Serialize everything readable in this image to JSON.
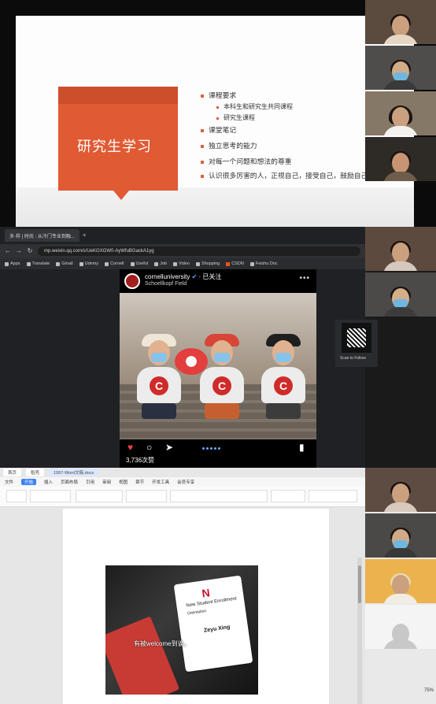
{
  "slide": {
    "title": "研究生学习",
    "bullets": [
      "课程要求",
      "本科生和研究生共同课程",
      "研究生课程",
      "课堂笔记",
      "独立思考的能力",
      "对每一个问题和想法的尊重",
      "认识很多厉害的人，正视自己，接受自己，鼓励自己"
    ]
  },
  "browser": {
    "tab_title": "多·样 | 时尚 : 从冷门专业到融...",
    "new_tab_symbol": "+",
    "url": "mp.weixin.qq.com/s/UeKGXGW0-AyWfuBGackA1yg",
    "bookmarks": [
      "Apps",
      "Translate",
      "Gmail",
      "Udemy",
      "Cornell",
      "Useful",
      "Job",
      "Video",
      "Shopping",
      "CSDN",
      "Feishu Doc"
    ],
    "post": {
      "user": "cornelluniversity",
      "follow_text": "· 已关注",
      "location": "Schoellkopf Field",
      "likes": "3,736次赞"
    },
    "qr_label": "Scan to Follow"
  },
  "wps": {
    "tabs": [
      "首页",
      "稻壳",
      "1997-Word文稿.docx"
    ],
    "menu": [
      "文件",
      "开始",
      "插入",
      "页面布局",
      "引用",
      "审阅",
      "视图",
      "章节",
      "开发工具",
      "会员专享"
    ],
    "doc_caption": "有被welcome到诶。",
    "card_lines": [
      "New Student Enrollment",
      "Orientation",
      "Zeyu Xing"
    ],
    "zoom_label": "75%"
  }
}
